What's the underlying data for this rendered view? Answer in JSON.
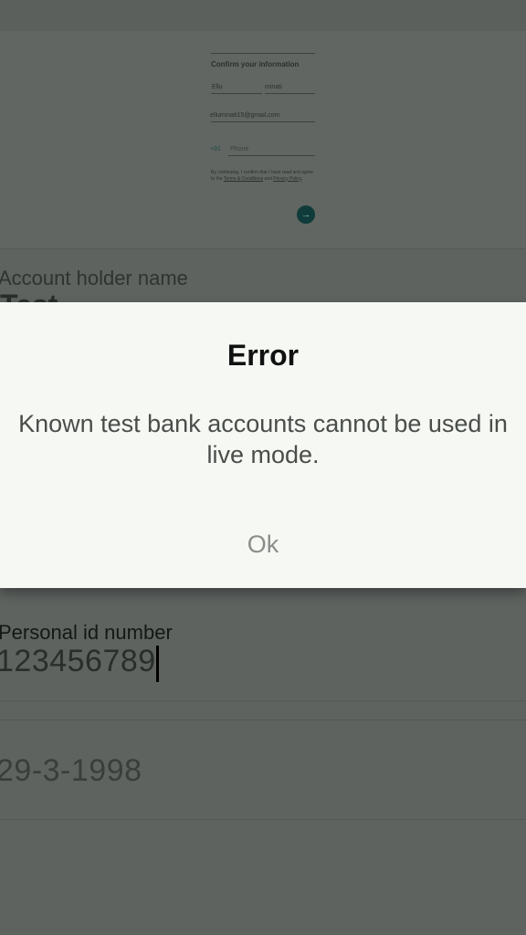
{
  "preview": {
    "title": "Confirm your information",
    "first_name": "Ellu",
    "last_name": "minati",
    "email": "elluminati15@gmail.com",
    "phone_code": "+91",
    "phone_placeholder": "Phone",
    "terms_prefix": "By continuing, I confirm that I have read and agree to the ",
    "terms_link": "Terms & Conditions",
    "terms_and": " and ",
    "privacy_link": "Privacy Policy",
    "terms_suffix": ".",
    "next_icon": "arrow-right-icon"
  },
  "fields": {
    "account_holder_label": "Account holder name",
    "account_holder_value": "Test",
    "personal_id_label": "Personal id number",
    "personal_id_value": "123456789",
    "dob_value": "29-3-1998"
  },
  "dialog": {
    "title": "Error",
    "message_line1": "Known test bank accounts cannot be used in",
    "message_line2": "live mode.",
    "ok_label": "Ok"
  },
  "colors": {
    "overlay": "#5f6360",
    "dialog_bg": "#f5f8f3",
    "accent": "#0f3b3a"
  }
}
